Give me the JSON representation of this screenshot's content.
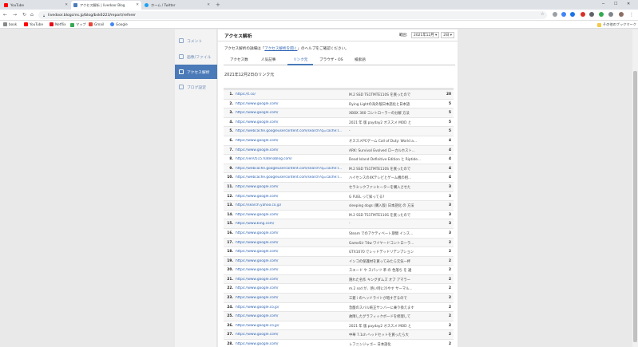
{
  "browser": {
    "tabs": [
      {
        "label": "YouTube",
        "color": "#ff0000"
      },
      {
        "label": "アクセス解析 | livedoor Blog",
        "color": "#4a7ab8"
      },
      {
        "label": "ホーム / Twitter",
        "color": "#1da1f2"
      }
    ],
    "address": "livedoor.blogcms.jp/blog/bsk6223/report/referer",
    "bookmarks": [
      {
        "label": "book",
        "color": "#888888"
      },
      {
        "label": "YouTube",
        "color": "#ff0000"
      },
      {
        "label": "Netflix",
        "color": "#e50914"
      },
      {
        "label": "マップ",
        "color": "#34a853"
      },
      {
        "label": "Gmail",
        "color": "#ea4335"
      },
      {
        "label": "Google",
        "color": "#4285f4"
      }
    ],
    "other_bookmarks": "その他のブックマーク"
  },
  "sidebar": {
    "items": [
      {
        "label": "コメント",
        "icon": "comment-icon"
      },
      {
        "label": "画像/ファイル",
        "icon": "image-icon"
      },
      {
        "label": "アクセス解析",
        "icon": "chart-icon"
      },
      {
        "label": "ブログ設定",
        "icon": "wrench-icon"
      }
    ]
  },
  "main": {
    "title": "アクセス解析",
    "period_label": "範囲：",
    "period_month": "2021年12月",
    "period_day": "2日",
    "help_prefix": "アクセス解析の詳細は「",
    "help_link": "アクセス解析を開く",
    "help_suffix": "」のヘルプをご確認ください。",
    "tabs": [
      "アクセス数",
      "人気記事",
      "リンク元",
      "ブラウザ・OS",
      "検索語"
    ],
    "date_heading": "2021年12月2日のリンク元"
  },
  "table_rows": [
    {
      "rank": "1.",
      "url": "https://t.co/",
      "title": "M.2 SSD TS1TMTE110S を買ったので",
      "count": "20"
    },
    {
      "rank": "2.",
      "url": "https://www.google.com/",
      "title": "Dying Lightの海外版日本語化と日本語",
      "count": "5"
    },
    {
      "rank": "3.",
      "url": "https://www.google.com/",
      "title": "XBOX 360 コントローラーの分解 方法",
      "count": "5"
    },
    {
      "rank": "4.",
      "url": "https://www.google.com/",
      "title": "2021 年 版 payday2 オススメ MOD と",
      "count": "5"
    },
    {
      "rank": "5.",
      "url": "https://webcache.googleusercontent.com/search?q=cache:I...",
      "title": "-",
      "count": "5"
    },
    {
      "rank": "6.",
      "url": "https://www.google.com/",
      "title": "オススメPCゲーム Call of Duty: World a...",
      "count": "4"
    },
    {
      "rank": "7.",
      "url": "https://www.google.com/",
      "title": "ARK: Survival Evolved ローカルホスト...",
      "count": "4"
    },
    {
      "rank": "8.",
      "url": "https://ieri0515.hatenablog.com/",
      "title": "Dead Island Definitive Edition と Riptide...",
      "count": "4"
    },
    {
      "rank": "9.",
      "url": "https://webcache.googleusercontent.com/search?q=cache:I...",
      "title": "M.2 SSD TS1TMTE110S を買ったので",
      "count": "4"
    },
    {
      "rank": "10.",
      "url": "https://webcache.googleusercontent.com/search?q=cache:I...",
      "title": "ハイセンスの4Kテレビとゲーム機の相...",
      "count": "4"
    },
    {
      "rank": "11.",
      "url": "https://www.google.com/",
      "title": "セラミックファンヒーターを購入させた",
      "count": "3"
    },
    {
      "rank": "12.",
      "url": "https://www.google.com/",
      "title": "G FUEL って知ってる?",
      "count": "3"
    },
    {
      "rank": "13.",
      "url": "https://search.yahoo.co.jp/",
      "title": "sleeping dogs (購入版) 日本語化 の 方法",
      "count": "3"
    },
    {
      "rank": "14.",
      "url": "https://www.google.com/",
      "title": "M.2 SSD TS1TMTE110S を買ったので",
      "count": "3"
    },
    {
      "rank": "15.",
      "url": "https://www.bing.com/",
      "title": "-",
      "count": "3"
    },
    {
      "rank": "16.",
      "url": "https://www.google.com/",
      "title": "Steam でのアクティベート期間 インス...",
      "count": "3"
    },
    {
      "rank": "17.",
      "url": "https://www.google.com/",
      "title": "GameSir T4w ワイヤードコントローラ...",
      "count": "2"
    },
    {
      "rank": "18.",
      "url": "https://www.google.com/",
      "title": "GTX1070 でレッドデッドリデンプション",
      "count": "2"
    },
    {
      "rank": "19.",
      "url": "https://www.google.com/",
      "title": "インコの保護材を買ってみたら元気一杯",
      "count": "2"
    },
    {
      "rank": "20.",
      "url": "https://www.google.com/",
      "title": "スエード や スパッツ 革 の 色落ち を 違",
      "count": "2"
    },
    {
      "rank": "21.",
      "url": "https://www.google.com/",
      "title": "隠れた名作 キングダムズ オブ アマラー",
      "count": "2"
    },
    {
      "rank": "22.",
      "url": "https://www.google.com/",
      "title": "m.2 ssd が、熱い時に冷やす サーマル...",
      "count": "2"
    },
    {
      "rank": "23.",
      "url": "https://www.google.com/",
      "title": "三菱 i のヘッドライトが暗すぎるので",
      "count": "2"
    },
    {
      "rank": "24.",
      "url": "https://www.google.co.jp/",
      "title": "急酸のスバル純正サンバーに乗り換えます",
      "count": "2"
    },
    {
      "rank": "25.",
      "url": "https://www.google.com/",
      "title": "故障したグラフィックボードを修理して",
      "count": "2"
    },
    {
      "rank": "26.",
      "url": "https://www.google.co.jp/",
      "title": "2021 年 版 payday2 オススメ MOD と",
      "count": "2"
    },
    {
      "rank": "27.",
      "url": "https://www.google.com/",
      "title": "中華 7.1ch ヘッドセットを買ったら大",
      "count": "2"
    },
    {
      "rank": "28.",
      "url": "https://www.google.com/",
      "title": "レフニンジャゴー 日本語化",
      "count": "2"
    }
  ]
}
